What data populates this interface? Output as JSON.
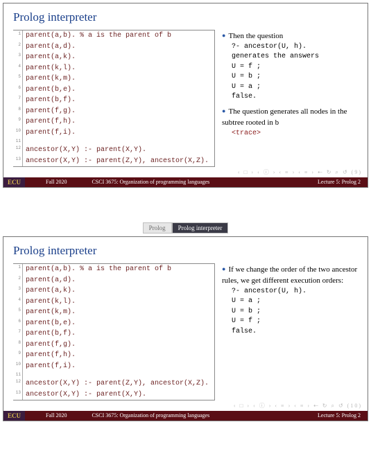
{
  "slide1": {
    "title": "Prolog interpreter",
    "code": [
      "parent(a,b). % a is the parent of b",
      "parent(a,d).",
      "parent(a,k).",
      "parent(k,l).",
      "parent(k,m).",
      "parent(b,e).",
      "parent(b,f).",
      "parent(f,g).",
      "parent(f,h).",
      "parent(f,i).",
      "",
      "ancestor(X,Y) :- parent(X,Y).",
      "ancestor(X,Y) :- parent(Z,Y), ancestor(X,Z)."
    ],
    "bullet1_text": "Then the question",
    "bullet1_code": "?- ancestor(U, h).\ngenerates the answers\nU = f ;\nU = b ;\nU = a ;\nfalse.",
    "bullet2_text": "The question generates all nodes in the subtree rooted in b",
    "bullet2_link": "<trace>",
    "nav": "‹ □ ›  ‹ ⓘ ›  ‹ ≡ ›  ‹ ≡ ›   ⇠  ↻ ⌕ ↺  (9)",
    "footer": {
      "ecu": "ECU",
      "sem": "Fall 2020",
      "course": "CSCI 3675: Organization of programming languages",
      "lec": "Lecture 5: Prolog 2"
    }
  },
  "tabs": {
    "left": "Prolog",
    "right": "Prolog interpreter"
  },
  "slide2": {
    "title": "Prolog interpreter",
    "code": [
      "parent(a,b). % a is the parent of b",
      "parent(a,d).",
      "parent(a,k).",
      "parent(k,l).",
      "parent(k,m).",
      "parent(b,e).",
      "parent(b,f).",
      "parent(f,g).",
      "parent(f,h).",
      "parent(f,i).",
      "",
      "ancestor(X,Y) :- parent(Z,Y), ancestor(X,Z).",
      "ancestor(X,Y) :- parent(X,Y)."
    ],
    "bullet1_text": "If we change the order of the two ancestor rules, we get different execution orders:",
    "bullet1_code": "?- ancestor(U, h).\nU = a ;\nU = b ;\nU = f ;\nfalse.",
    "nav": "‹ □ ›  ‹ ⓘ ›  ‹ ≡ ›  ‹ ≡ ›   ⇠  ↻ ⌕ ↺  (10)",
    "footer": {
      "ecu": "ECU",
      "sem": "Fall 2020",
      "course": "CSCI 3675: Organization of programming languages",
      "lec": "Lecture 5: Prolog 2"
    }
  }
}
